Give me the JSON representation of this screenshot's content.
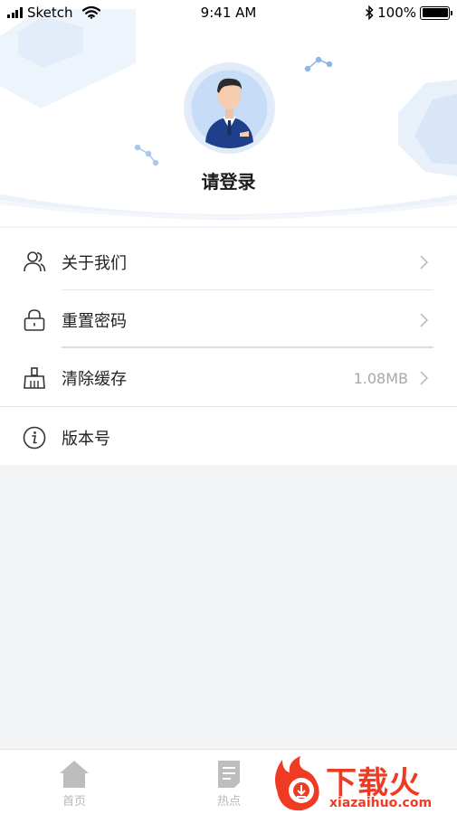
{
  "status_bar": {
    "carrier": "Sketch",
    "time": "9:41 AM",
    "battery": "100%"
  },
  "profile": {
    "login_prompt": "请登录"
  },
  "menu": {
    "items": [
      {
        "label": "关于我们",
        "icon": "users-icon",
        "value": ""
      },
      {
        "label": "重置密码",
        "icon": "lock-icon",
        "value": ""
      },
      {
        "label": "清除缓存",
        "icon": "broom-icon",
        "value": "1.08MB"
      },
      {
        "label": "版本号",
        "icon": "info-icon",
        "value": ""
      }
    ]
  },
  "tabbar": {
    "tabs": [
      {
        "label": "首页",
        "icon": "home-icon"
      },
      {
        "label": "热点",
        "icon": "document-icon"
      }
    ]
  },
  "watermark": {
    "title": "下载火",
    "url": "xiazaihuo.com"
  },
  "colors": {
    "accent_blue": "#2f69c7",
    "watermark_red": "#ef3a24",
    "page_bg": "#f3f4f6"
  }
}
